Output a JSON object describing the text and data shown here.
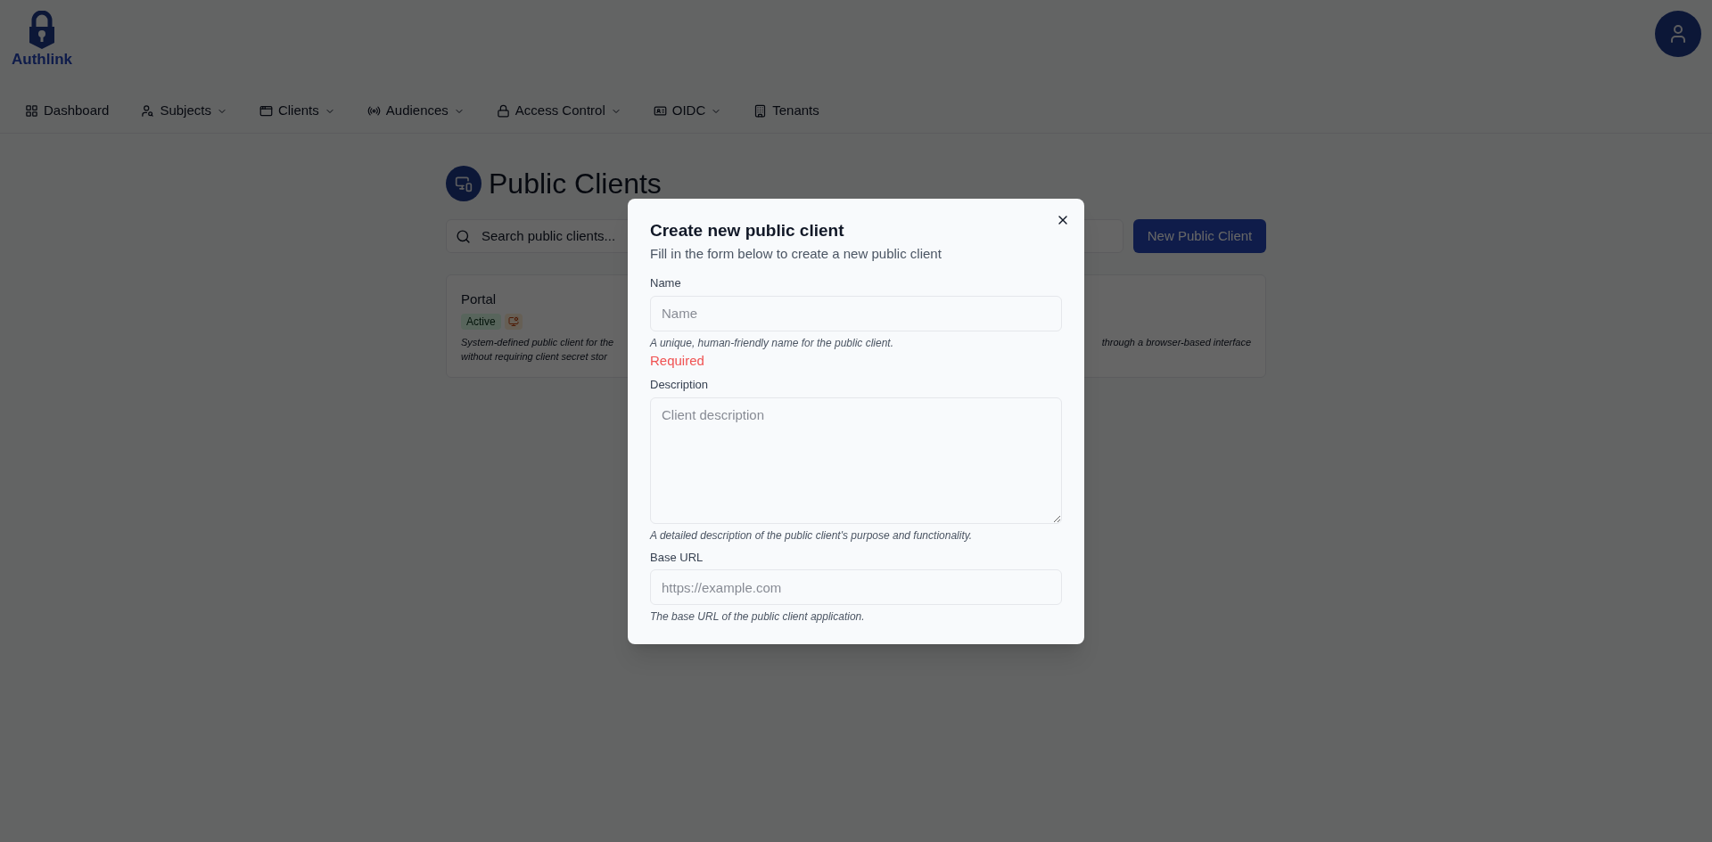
{
  "brand": {
    "name": "Authlink"
  },
  "nav": [
    {
      "label": "Dashboard",
      "dropdown": false
    },
    {
      "label": "Subjects",
      "dropdown": true
    },
    {
      "label": "Clients",
      "dropdown": true
    },
    {
      "label": "Audiences",
      "dropdown": true
    },
    {
      "label": "Access Control",
      "dropdown": true
    },
    {
      "label": "OIDC",
      "dropdown": true
    },
    {
      "label": "Tenants",
      "dropdown": false
    }
  ],
  "page": {
    "title": "Public Clients",
    "search": {
      "placeholder": "Search public clients..."
    },
    "new_button": "New Public Client"
  },
  "clients": [
    {
      "name": "Portal",
      "status": "Active",
      "description_left": "System-defined public client for the",
      "description_left_2": "without requiring client secret stor",
      "description_right": "through a browser-based interface"
    }
  ],
  "dialog": {
    "title": "Create new public client",
    "subtitle": "Fill in the form below to create a new public client",
    "fields": [
      {
        "kind": "input",
        "label": "Name",
        "placeholder": "Name",
        "help": "A unique, human-friendly name for the public client.",
        "error": "Required"
      },
      {
        "kind": "textarea",
        "label": "Description",
        "placeholder": "Client description",
        "help": "A detailed description of the public client's purpose and functionality."
      },
      {
        "kind": "input",
        "label": "Base URL",
        "placeholder": "https://example.com",
        "help": "The base URL of the public client application."
      }
    ]
  }
}
